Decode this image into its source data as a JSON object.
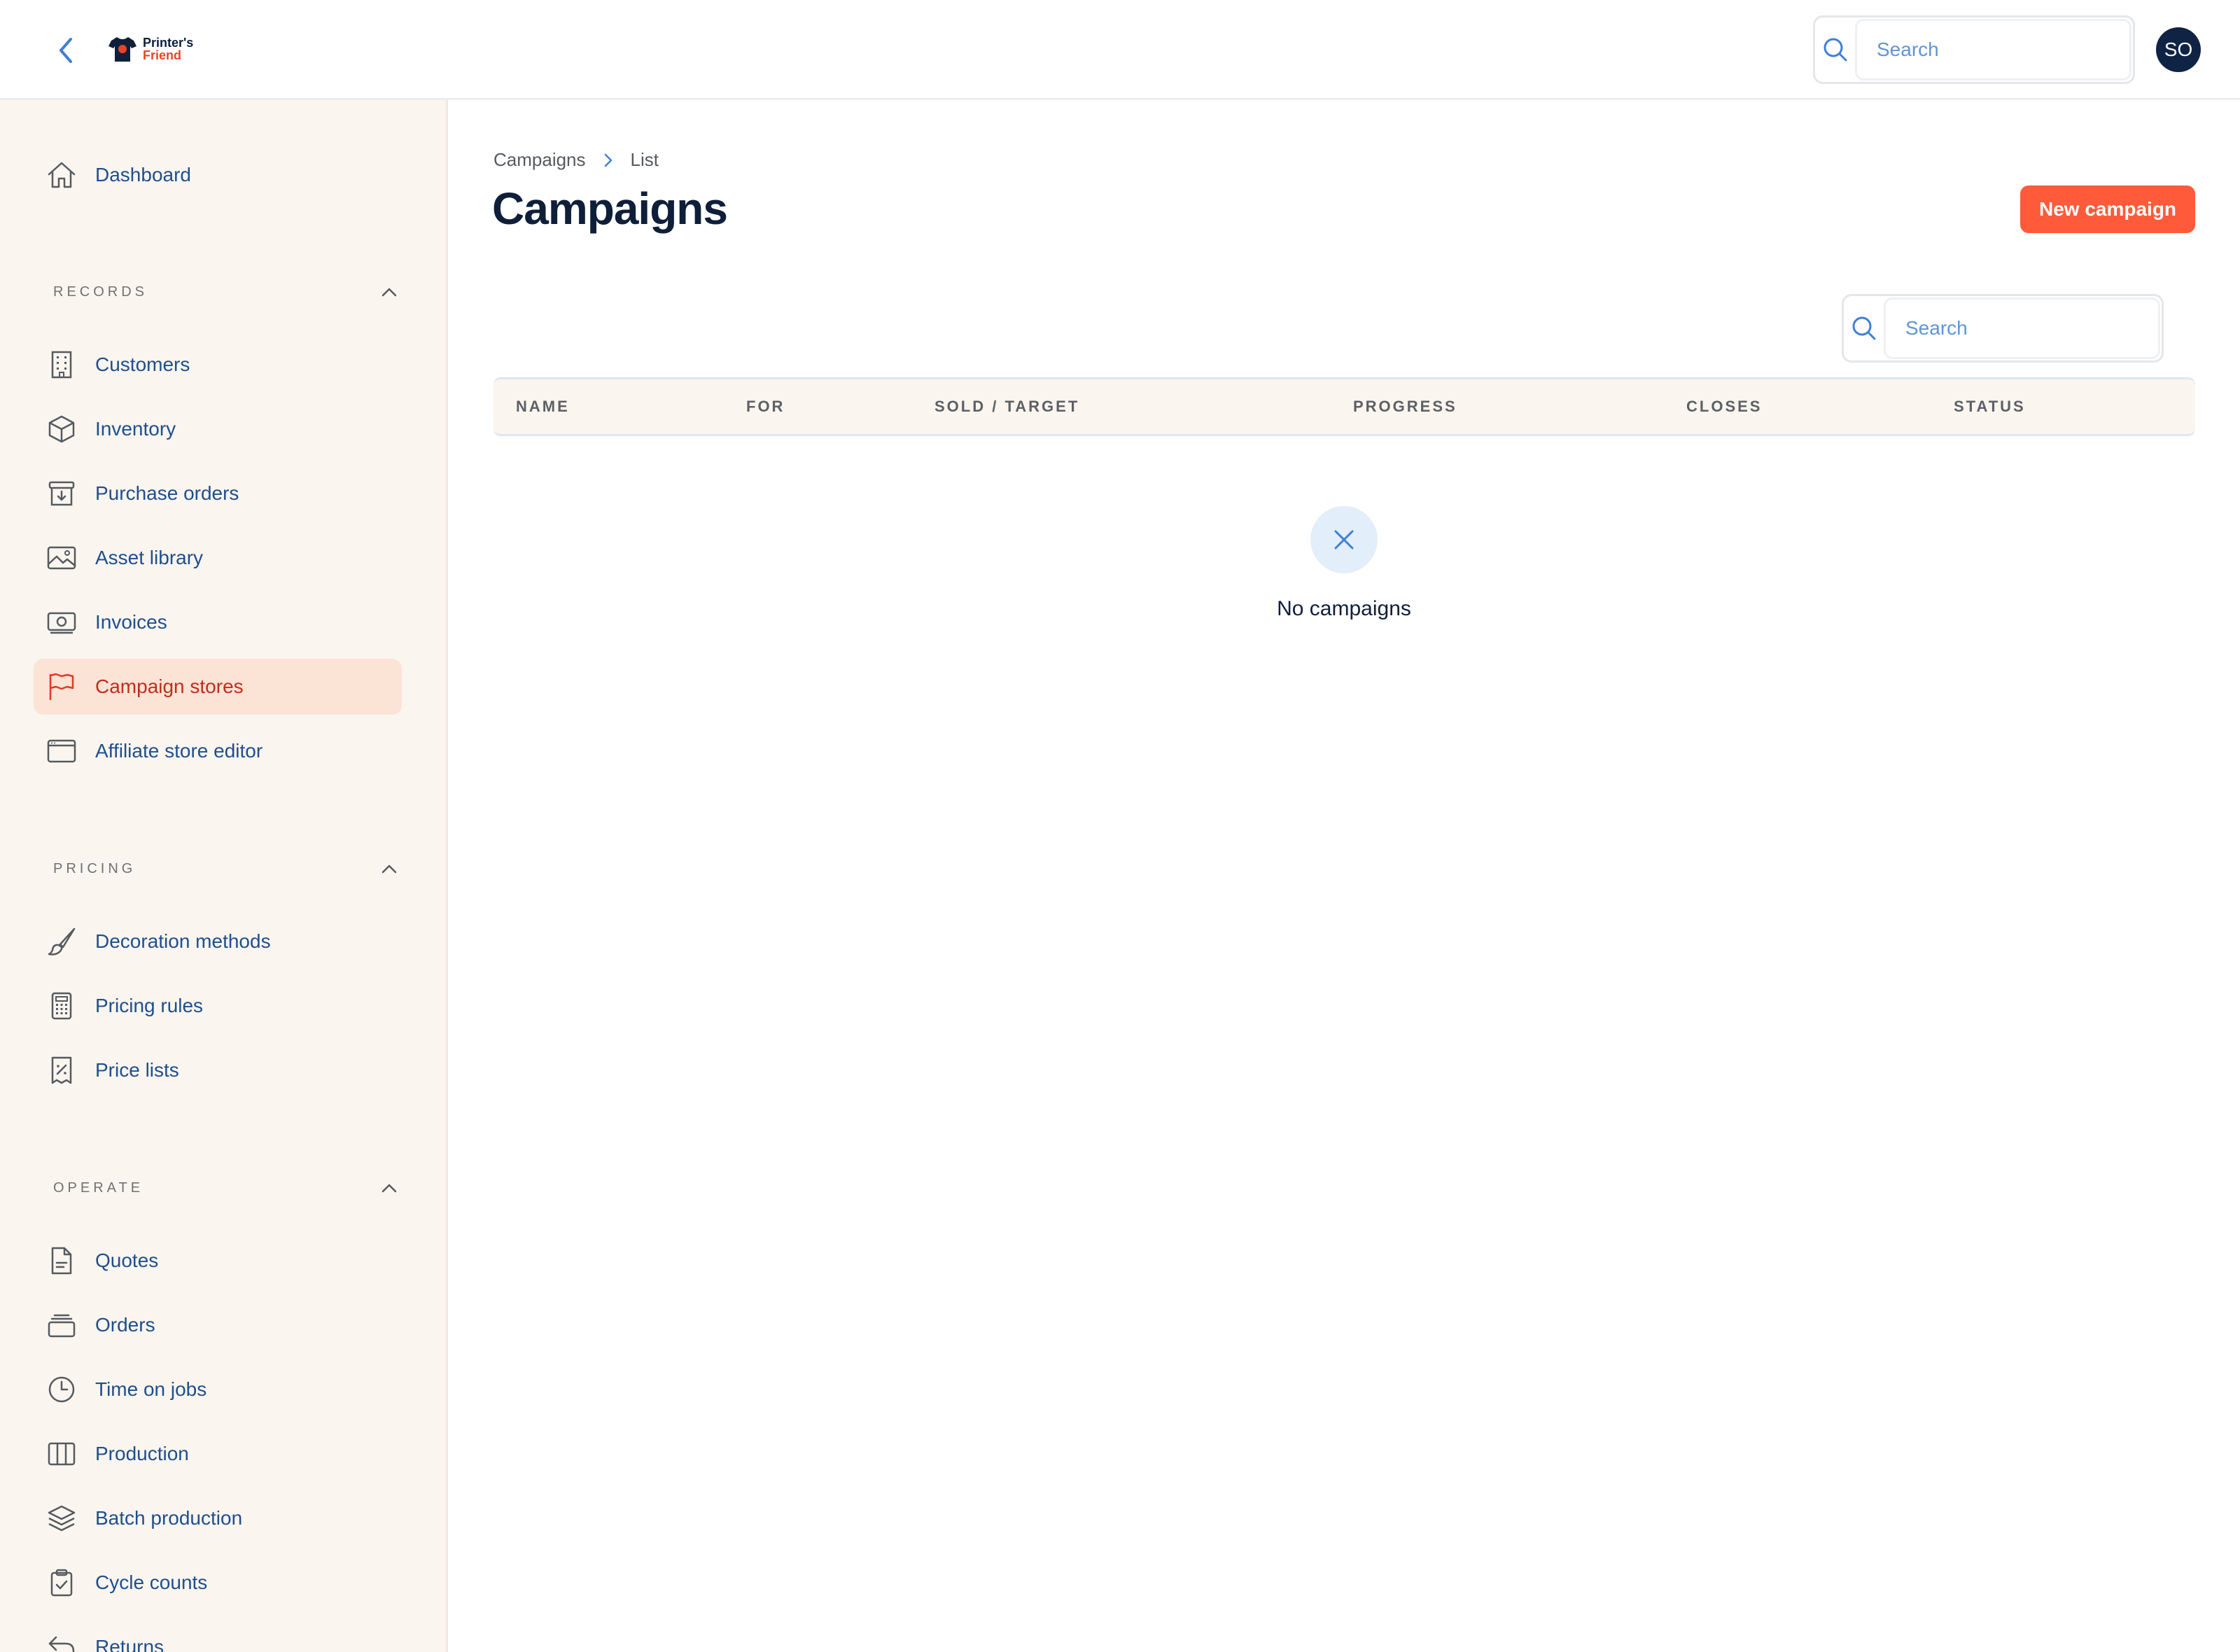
{
  "header": {
    "logo_line1": "Printer's",
    "logo_line2": "Friend",
    "search_placeholder": "Search",
    "avatar_initials": "SO"
  },
  "sidebar": {
    "dashboard": "Dashboard",
    "sections": [
      {
        "title": "RECORDS",
        "items": [
          "Customers",
          "Inventory",
          "Purchase orders",
          "Asset library",
          "Invoices",
          "Campaign stores",
          "Affiliate store editor"
        ]
      },
      {
        "title": "PRICING",
        "items": [
          "Decoration methods",
          "Pricing rules",
          "Price lists"
        ]
      },
      {
        "title": "OPERATE",
        "items": [
          "Quotes",
          "Orders",
          "Time on jobs",
          "Production",
          "Batch production",
          "Cycle counts",
          "Returns"
        ]
      }
    ],
    "active_item": "Campaign stores"
  },
  "main": {
    "breadcrumb": [
      "Campaigns",
      "List"
    ],
    "title": "Campaigns",
    "new_button": "New campaign",
    "table_search_placeholder": "Search",
    "columns": [
      "NAME",
      "FOR",
      "SOLD / TARGET",
      "PROGRESS",
      "CLOSES",
      "STATUS"
    ],
    "empty_text": "No campaigns"
  },
  "colors": {
    "accent": "#ff5a3a",
    "active_bg": "#fbe3d6",
    "sidebar_bg": "#faf5ee",
    "link": "#1e4f8f",
    "title": "#0f1f3a"
  }
}
